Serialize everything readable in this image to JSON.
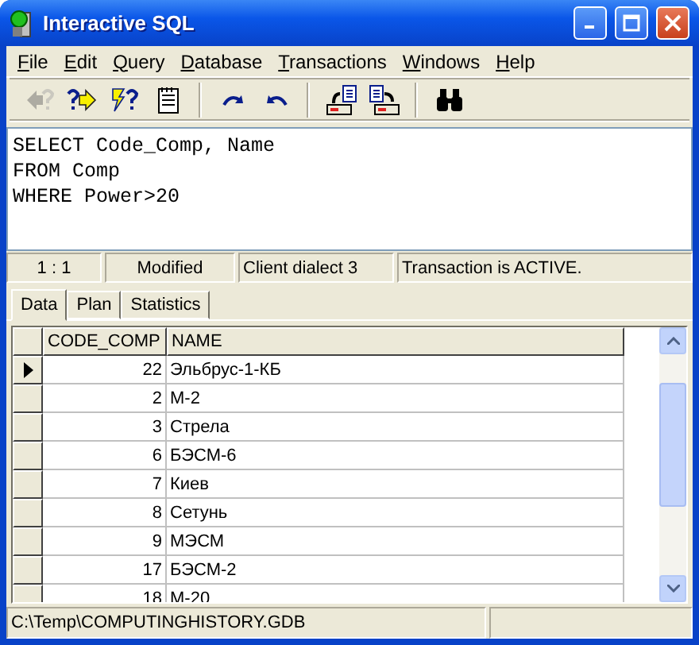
{
  "window": {
    "title": "Interactive SQL"
  },
  "menu": [
    "File",
    "Edit",
    "Query",
    "Database",
    "Transactions",
    "Windows",
    "Help"
  ],
  "toolbar": [
    {
      "kind": "prev",
      "disabled": true
    },
    {
      "kind": "next",
      "disabled": false
    },
    {
      "kind": "execute",
      "disabled": false
    },
    {
      "kind": "notepad",
      "disabled": false
    },
    {
      "kind": "redo",
      "disabled": false
    },
    {
      "kind": "undo",
      "disabled": false
    },
    {
      "kind": "load",
      "disabled": false
    },
    {
      "kind": "save",
      "disabled": false
    },
    {
      "kind": "find",
      "disabled": false
    }
  ],
  "editor": {
    "lines": [
      "SELECT Code_Comp, Name",
      "FROM Comp",
      "WHERE Power>20"
    ]
  },
  "editor_status": [
    "1 :  1",
    "Modified",
    "Client dialect 3",
    "Transaction is ACTIVE."
  ],
  "tabs": [
    {
      "label": "Data",
      "selected": true
    },
    {
      "label": "Plan",
      "selected": false
    },
    {
      "label": "Statistics",
      "selected": false
    }
  ],
  "table": {
    "columns": [
      "CODE_COMP",
      "NAME"
    ],
    "rows": [
      {
        "cells": [
          "22",
          "Эльбрус-1-КБ"
        ],
        "current": true
      },
      {
        "cells": [
          "2",
          "М-2"
        ],
        "current": false
      },
      {
        "cells": [
          "3",
          "Стрела"
        ],
        "current": false
      },
      {
        "cells": [
          "6",
          "БЭСМ-6"
        ],
        "current": false
      },
      {
        "cells": [
          "7",
          "Киев"
        ],
        "current": false
      },
      {
        "cells": [
          "8",
          "Сетунь"
        ],
        "current": false
      },
      {
        "cells": [
          "9",
          "МЭСМ"
        ],
        "current": false
      },
      {
        "cells": [
          "17",
          "БЭСМ-2"
        ],
        "current": false
      },
      {
        "cells": [
          "18",
          "М-20"
        ],
        "current": false
      }
    ]
  },
  "status_bar": [
    "C:\\Temp\\COMPUTINGHISTORY.GDB"
  ]
}
